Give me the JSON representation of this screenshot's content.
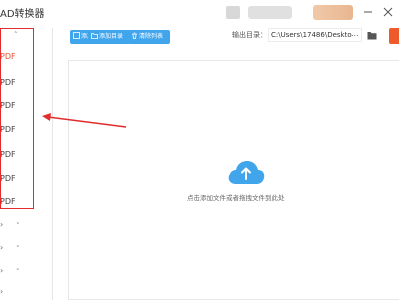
{
  "window": {
    "title": "AD转换器"
  },
  "toolbar": {
    "add_file": "添加文件",
    "add_folder": "添加目录",
    "clear_list": "清除列表",
    "output_label": "输出目录：",
    "output_path": "C:\\Users\\17486\\Deskto",
    "more": "..."
  },
  "sidebar": {
    "items": [
      {
        "label": "",
        "icon": "chevron-up"
      },
      {
        "label": "PDF",
        "active": true
      },
      {
        "label": "PDF"
      },
      {
        "label": "PDF"
      },
      {
        "label": "PDF"
      },
      {
        "label": "PDF"
      },
      {
        "label": "PDF"
      },
      {
        "label": "PDF"
      }
    ],
    "collapsed_groups": [
      "chevron-down-icon",
      "chevron-down-icon",
      "chevron-down-icon",
      "chevron-down-icon"
    ]
  },
  "main": {
    "drop_hint": "点击添加文件或者拖拽文件到此处"
  },
  "colors": {
    "accent_blue": "#41a5ec",
    "highlight_red": "#e02d2d",
    "active_text": "#e8512f",
    "convert_orange": "#ef5a2a"
  }
}
